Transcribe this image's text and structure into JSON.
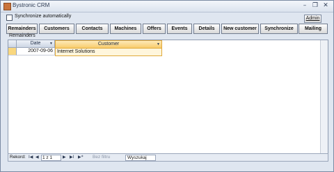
{
  "window": {
    "title": "Bystronic CRM"
  },
  "window_controls": {
    "minimize": "–",
    "restore": "❐",
    "close": "✕"
  },
  "options": {
    "sync_label": "Synchronize automatically",
    "sync_checked": false
  },
  "admin_button": "Admin",
  "toolbar": {
    "buttons": [
      "Remainders",
      "Customers",
      "Contacts",
      "Machines",
      "Offers",
      "Events",
      "Details",
      "New customer",
      "Synchronize",
      "Mailing"
    ]
  },
  "panel_label": "Remainders",
  "grid": {
    "columns": [
      "Date",
      "Customer"
    ],
    "rows": [
      {
        "date": "2007-09-06",
        "customer": "Internet Solutions"
      }
    ]
  },
  "navigation": {
    "record_label": "Rekord:",
    "first": "I◀",
    "prev": "◀",
    "position": "1 z 1",
    "next": "▶",
    "last": "▶I",
    "new": "▶*",
    "filter_label": "Bez filtru",
    "search_placeholder": "Wyszukaj"
  }
}
